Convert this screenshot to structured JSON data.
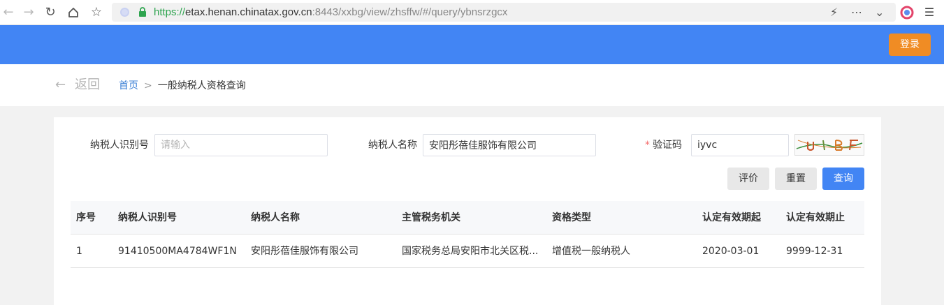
{
  "browser": {
    "url_scheme": "https://",
    "url_host": "etax.henan.chinatax.gov.cn",
    "url_path": ":8443/xxbg/view/zhsffw/#/query/ybnsrzgcx",
    "icons": [
      "back-icon",
      "forward-icon",
      "reload-icon",
      "home-icon",
      "bookmark-star-icon",
      "shield-icon",
      "lock-icon",
      "lightning-icon",
      "more-icon",
      "chevron-down-icon",
      "extension-icon",
      "menu-icon"
    ]
  },
  "header": {
    "login_label": "登录"
  },
  "breadcrumb": {
    "back_label": "返回",
    "home_label": "首页",
    "separator": ">",
    "current_label": "一般纳税人资格查询"
  },
  "form": {
    "taxpayer_id_label": "纳税人识别号",
    "taxpayer_id_value": "",
    "taxpayer_id_placeholder": "请输入",
    "taxpayer_name_label": "纳税人名称",
    "taxpayer_name_value": "安阳彤蓓佳服饰有限公司",
    "captcha_label": "验证码",
    "captcha_required_mark": "*",
    "captcha_value": "iyvc",
    "evaluate_label": "评价",
    "reset_label": "重置",
    "query_label": "查询"
  },
  "table": {
    "headers": [
      "序号",
      "纳税人识别号",
      "纳税人名称",
      "主管税务机关",
      "资格类型",
      "认定有效期起",
      "认定有效期止"
    ],
    "rows": [
      [
        "1",
        "91410500MA4784WF1N",
        "安阳彤蓓佳服饰有限公司",
        "国家税务总局安阳市北关区税...",
        "增值税一般纳税人",
        "2020-03-01",
        "9999-12-31"
      ]
    ]
  },
  "colors": {
    "header_blue": "#4285f4",
    "login_orange": "#f08c24",
    "link_blue": "#3a7fd5",
    "required_red": "#f56c6c"
  }
}
